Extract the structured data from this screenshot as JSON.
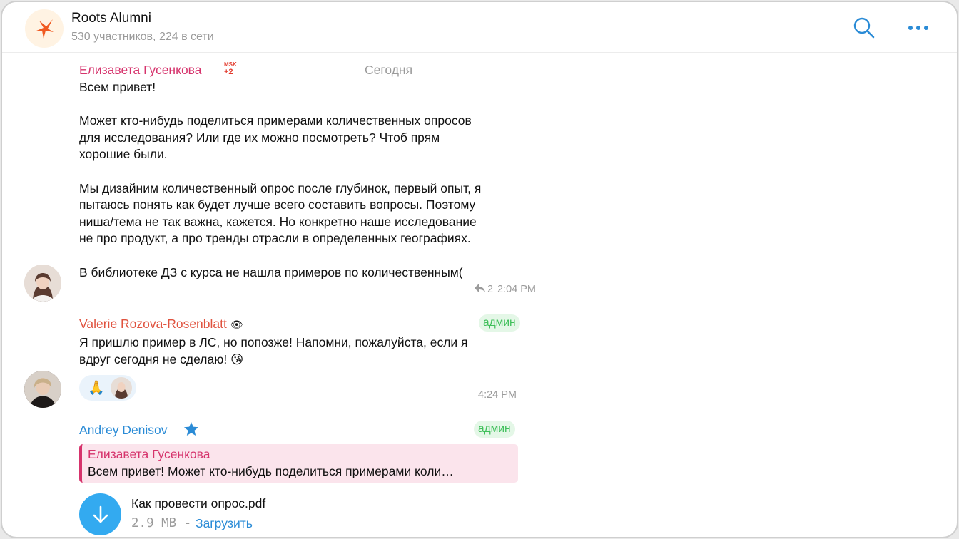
{
  "chat": {
    "title": "Roots Alumni",
    "subtitle": "530 участников, 224 в сети"
  },
  "date_separator": "Сегодня",
  "messages": [
    {
      "author": "Елизавета Гусенкова",
      "author_color": "#d6336c",
      "tag_top": "MSK",
      "tag_bottom": "+2",
      "text": "Всем привет!\n\nМожет кто-нибудь поделиться примерами количественных опросов\nдля исследования? Или где их можно посмотреть? Чтоб прям\nхорошие были.\n\nМы дизайним количественный опрос после глубинок, первый опыт, я\nпытаюсь понять как будет лучше всего составить вопросы. Поэтому\nниша/тема не так важна, кажется. Но конкретно наше исследование\nне про продукт, а про тренды отрасли в определенных географиях.\n\nВ библиотеке ДЗ с курса не нашла примеров по количественным(",
      "replies": "2",
      "time": "2:04 PM"
    },
    {
      "author": "Valerie Rozova-Rosenblatt",
      "author_color": "#e0533f",
      "author_suffix": "👁",
      "badge": "админ",
      "text": "Я пришлю пример в ЛС, но попозже! Напомни, пожалуйста, если я\nвдруг сегодня не сделаю! 😘",
      "reaction": "🙏",
      "time": "4:24 PM"
    },
    {
      "author": "Andrey Denisov",
      "author_color": "#2a8bd6",
      "badge": "админ",
      "reply_to": {
        "author": "Елизавета Гусенкова",
        "text": "Всем привет!  Может кто-нибудь поделиться примерами коли…"
      },
      "file": {
        "name": "Как провести опрос.pdf",
        "size": "2.9 MB -",
        "action": "Загрузить"
      }
    }
  ],
  "colors": {
    "accent": "#2a8bd6",
    "admin_badge": "#3fbf5a",
    "file_button": "#33aaf0"
  },
  "icons": [
    "app-logo-icon",
    "search-icon",
    "more-icon",
    "reply-arrow-icon",
    "star-icon",
    "download-arrow-icon"
  ]
}
